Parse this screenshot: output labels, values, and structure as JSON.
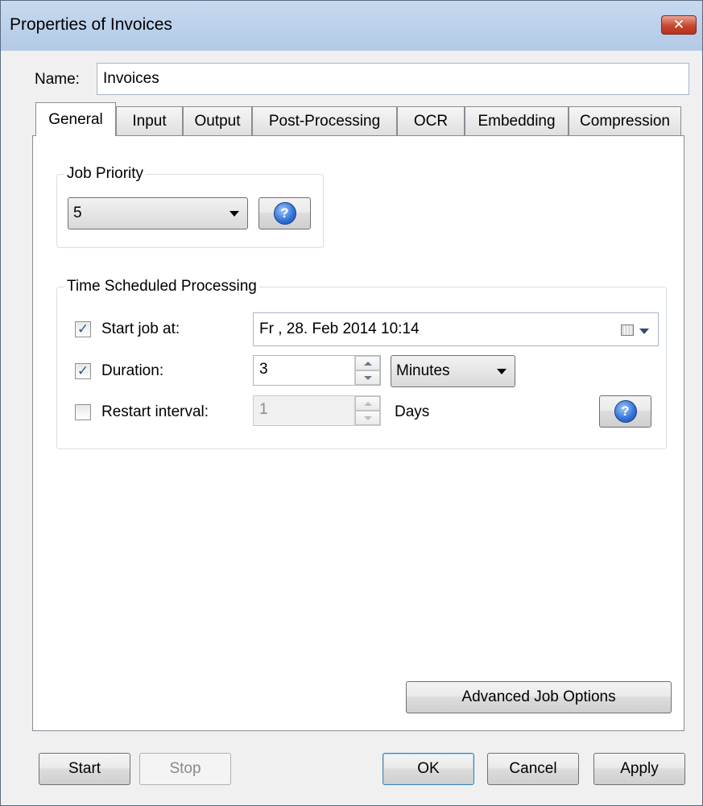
{
  "window": {
    "title": "Properties of Invoices",
    "close_glyph": "✕"
  },
  "name_field": {
    "label": "Name:",
    "value": "Invoices"
  },
  "tabs": [
    {
      "label": "General",
      "active": true
    },
    {
      "label": "Input",
      "active": false
    },
    {
      "label": "Output",
      "active": false
    },
    {
      "label": "Post-Processing",
      "active": false
    },
    {
      "label": "OCR",
      "active": false
    },
    {
      "label": "Embedding",
      "active": false
    },
    {
      "label": "Compression",
      "active": false
    }
  ],
  "job_priority": {
    "legend": "Job Priority",
    "selected": "5",
    "help_glyph": "?"
  },
  "schedule": {
    "legend": "Time Scheduled Processing",
    "start_job": {
      "label": "Start job at:",
      "checked": true,
      "value": "Fr , 28. Feb 2014 10:14"
    },
    "duration": {
      "label": "Duration:",
      "checked": true,
      "value": "3",
      "unit": "Minutes"
    },
    "restart": {
      "label": "Restart interval:",
      "checked": false,
      "value": "1",
      "unit": "Days"
    },
    "help_glyph": "?"
  },
  "advanced_button": "Advanced Job Options",
  "footer": {
    "start": "Start",
    "stop": "Stop",
    "ok": "OK",
    "cancel": "Cancel",
    "apply": "Apply"
  },
  "check_glyph": "✓",
  "colors": {
    "titlebar": "#c6d9ef",
    "close_button": "#c7472f",
    "help_icon": "#2d6fd6",
    "check": "#33538e"
  }
}
